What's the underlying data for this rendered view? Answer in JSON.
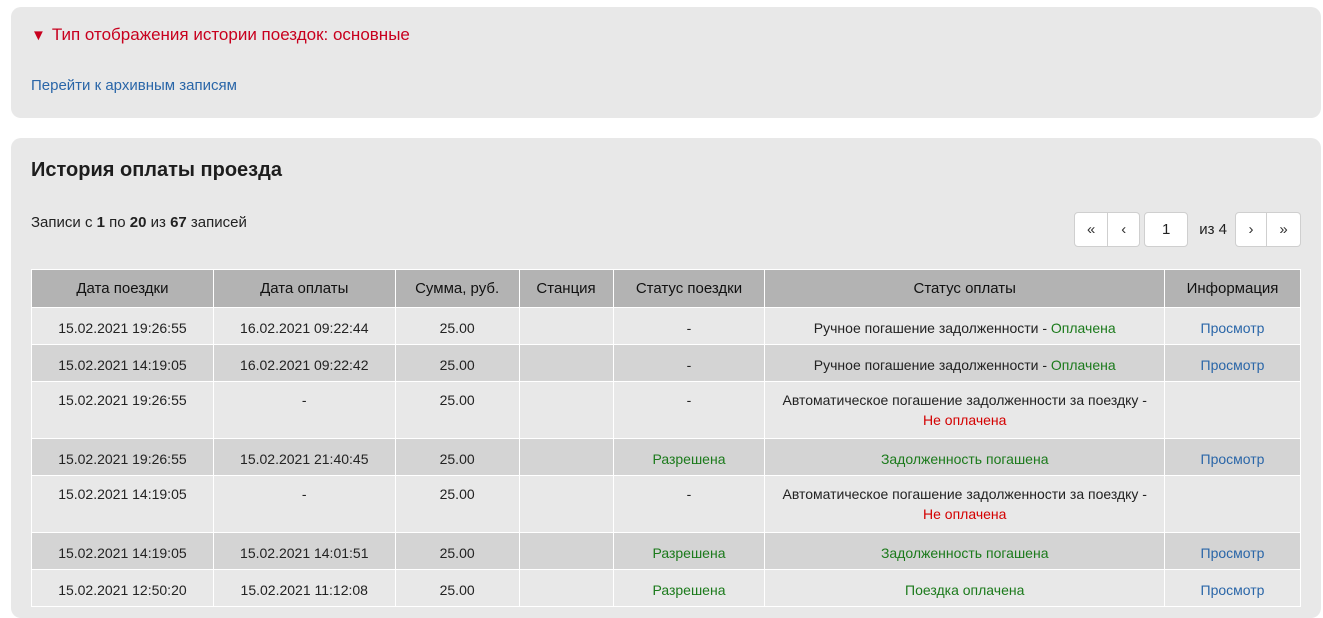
{
  "filter": {
    "toggle_icon": "▼",
    "toggle_label": "Тип отображения истории поездок: основные",
    "archive_link": "Перейти к архивным записям"
  },
  "history": {
    "title": "История оплаты проезда",
    "records": {
      "prefix": "Записи с ",
      "from": "1",
      "mid1": " по ",
      "to": "20",
      "mid2": " из ",
      "total": "67",
      "suffix": " записей"
    },
    "pager": {
      "first": "«",
      "prev": "‹",
      "current_page": "1",
      "of_total": "из 4",
      "next": "›",
      "last": "»"
    },
    "columns": [
      "Дата поездки",
      "Дата оплаты",
      "Сумма, руб.",
      "Станция",
      "Статус поездки",
      "Статус оплаты",
      "Информация"
    ],
    "rows": [
      {
        "trip_date": "15.02.2021 19:26:55",
        "pay_date": "16.02.2021 09:22:44",
        "sum": "25.00",
        "station": "",
        "trip_status": "-",
        "trip_status_color": "default",
        "pay_status_text": "Ручное погашение задолженности - ",
        "pay_status_value": "Оплачена",
        "pay_status_color": "ok",
        "info": "Просмотр"
      },
      {
        "trip_date": "15.02.2021 14:19:05",
        "pay_date": "16.02.2021 09:22:42",
        "sum": "25.00",
        "station": "",
        "trip_status": "-",
        "trip_status_color": "default",
        "pay_status_text": "Ручное погашение задолженности - ",
        "pay_status_value": "Оплачена",
        "pay_status_color": "ok",
        "info": "Просмотр"
      },
      {
        "trip_date": "15.02.2021 19:26:55",
        "pay_date": "-",
        "sum": "25.00",
        "station": "",
        "trip_status": "-",
        "trip_status_color": "default",
        "pay_status_text": "Автоматическое погашение задолженности за поездку - ",
        "pay_status_value": "Не оплачена",
        "pay_status_color": "bad",
        "info": "",
        "multi": true
      },
      {
        "trip_date": "15.02.2021 19:26:55",
        "pay_date": "15.02.2021 21:40:45",
        "sum": "25.00",
        "station": "",
        "trip_status": "Разрешена",
        "trip_status_color": "ok",
        "pay_status_text": "",
        "pay_status_value": "Задолженность погашена",
        "pay_status_color": "ok",
        "info": "Просмотр"
      },
      {
        "trip_date": "15.02.2021 14:19:05",
        "pay_date": "-",
        "sum": "25.00",
        "station": "",
        "trip_status": "-",
        "trip_status_color": "default",
        "pay_status_text": "Автоматическое погашение задолженности за поездку - ",
        "pay_status_value": "Не оплачена",
        "pay_status_color": "bad",
        "info": "",
        "multi": true
      },
      {
        "trip_date": "15.02.2021 14:19:05",
        "pay_date": "15.02.2021 14:01:51",
        "sum": "25.00",
        "station": "",
        "trip_status": "Разрешена",
        "trip_status_color": "ok",
        "pay_status_text": "",
        "pay_status_value": "Задолженность погашена",
        "pay_status_color": "ok",
        "info": "Просмотр"
      },
      {
        "trip_date": "15.02.2021 12:50:20",
        "pay_date": "15.02.2021 11:12:08",
        "sum": "25.00",
        "station": "",
        "trip_status": "Разрешена",
        "trip_status_color": "ok",
        "pay_status_text": "",
        "pay_status_value": "Поездка оплачена",
        "pay_status_color": "ok",
        "info": "Просмотр"
      }
    ]
  },
  "colors": {
    "panel_bg": "#e8e8e8",
    "header_bg": "#b3b3b3",
    "row_alt_bg": "#d4d4d4",
    "accent_red": "#c8001e",
    "link_blue": "#2a66a8",
    "ok_green": "#1b7a1b",
    "bad_red": "#d40000"
  }
}
